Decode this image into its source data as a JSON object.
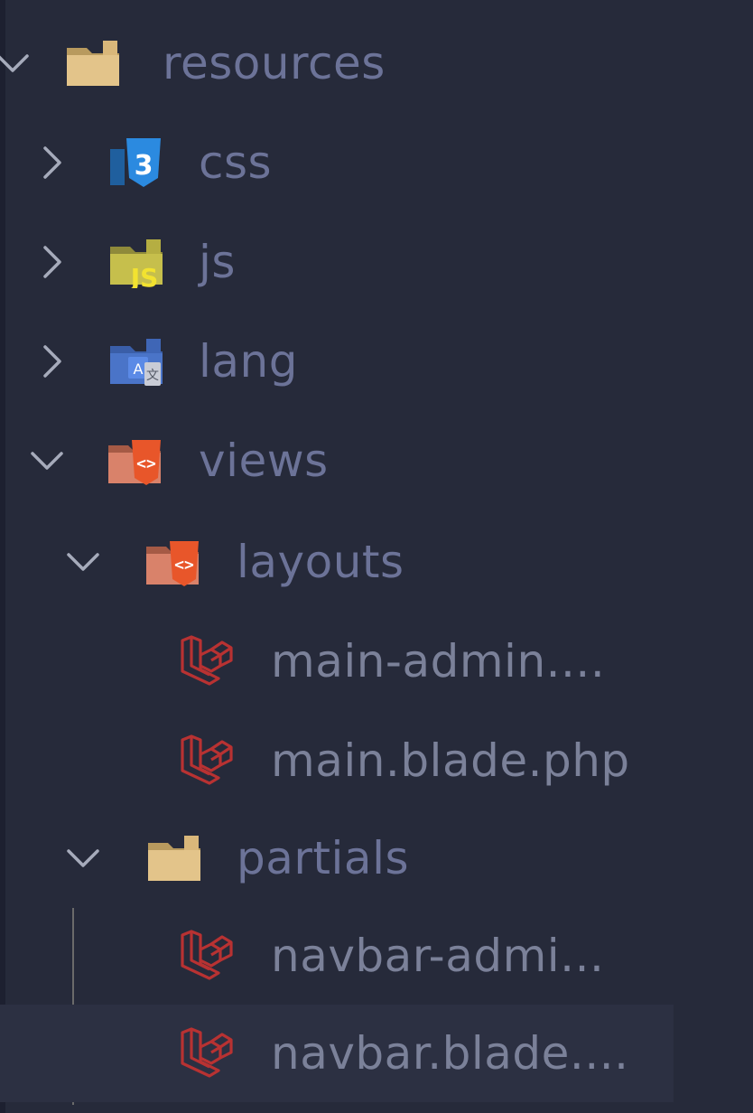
{
  "explorer": {
    "items": [
      {
        "label": "resources",
        "kind": "folder",
        "icon": "folder-icon",
        "expanded": true,
        "depth": 0
      },
      {
        "label": "css",
        "kind": "folder",
        "icon": "css-folder-icon",
        "expanded": false,
        "depth": 1
      },
      {
        "label": "js",
        "kind": "folder",
        "icon": "js-folder-icon",
        "expanded": false,
        "depth": 1
      },
      {
        "label": "lang",
        "kind": "folder",
        "icon": "lang-folder-icon",
        "expanded": false,
        "depth": 1
      },
      {
        "label": "views",
        "kind": "folder",
        "icon": "views-folder-icon",
        "expanded": true,
        "depth": 1
      },
      {
        "label": "layouts",
        "kind": "folder",
        "icon": "views-folder-icon",
        "expanded": true,
        "depth": 2
      },
      {
        "label": "main-admin....",
        "kind": "file",
        "icon": "laravel-icon",
        "depth": 3
      },
      {
        "label": "main.blade.php",
        "kind": "file",
        "icon": "laravel-icon",
        "depth": 3
      },
      {
        "label": "partials",
        "kind": "folder",
        "icon": "folder-icon",
        "expanded": true,
        "depth": 2
      },
      {
        "label": "navbar-admi...",
        "kind": "file",
        "icon": "laravel-icon",
        "depth": 3
      },
      {
        "label": "navbar.blade....",
        "kind": "file",
        "icon": "laravel-icon",
        "depth": 3,
        "selected": true
      }
    ]
  },
  "colors": {
    "background": "#262a3a",
    "label": "#6c7398",
    "selection": "#2c3042",
    "folder": "#d9b77a",
    "css": "#2b7fd4",
    "js": "#c6bf4c",
    "html": "#e8562a",
    "laravel": "#c03232"
  }
}
